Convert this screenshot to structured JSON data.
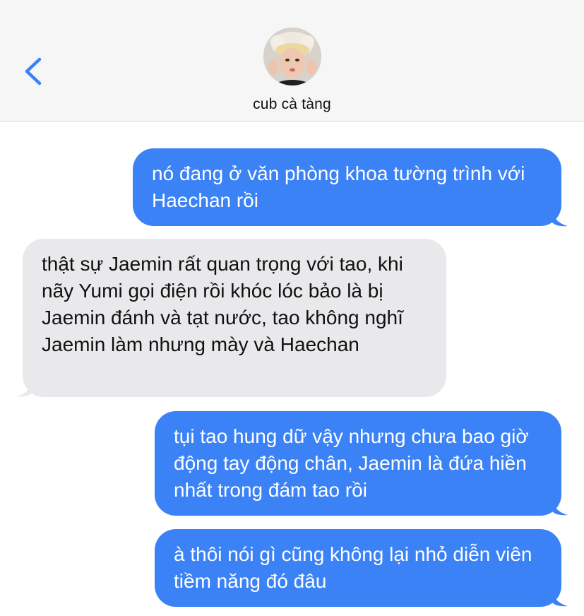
{
  "header": {
    "contact_name": "cub cà tàng",
    "back_icon": "chevron-left-icon",
    "avatar": "contact-avatar-photo",
    "accent_color": "#3b82f6"
  },
  "messages": [
    {
      "direction": "sent",
      "text": "nó đang ở văn phòng khoa tường trình với Haechan rồi"
    },
    {
      "direction": "received",
      "text": "thật sự Jaemin rất quan trọng với tao, khi nãy Yumi gọi điện rồi khóc lóc bảo là bị Jaemin đánh và tạt nước, tao không nghĩ Jaemin làm nhưng mày và Haechan"
    },
    {
      "direction": "sent",
      "text": "tụi tao hung dữ vậy nhưng chưa bao giờ động tay động chân, Jaemin là đứa hiền nhất trong đám tao rồi"
    },
    {
      "direction": "sent",
      "text": "à thôi nói gì cũng không lại nhỏ diễn viên tiềm năng đó đâu"
    }
  ],
  "colors": {
    "sent_bubble": "#3b82f6",
    "received_bubble": "#e9e9eb",
    "header_bg": "#f6f6f6"
  }
}
